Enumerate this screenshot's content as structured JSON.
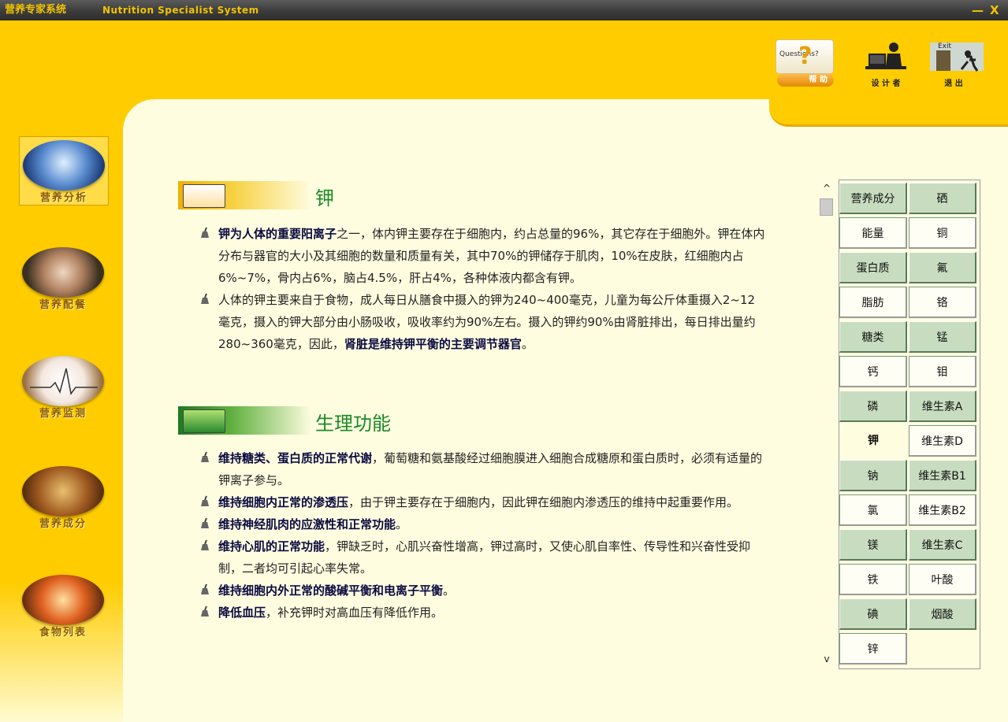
{
  "window": {
    "title_cn": "营养专家系统",
    "title_en": "Nutrition Specialist System",
    "minimize_glyph": "—",
    "close_glyph": "X"
  },
  "toolbar": {
    "help": {
      "card_text": "Questions?",
      "label": "帮 助"
    },
    "designer": {
      "label": "设 计 者"
    },
    "exit": {
      "label": "退 出",
      "sign_text": "Exit"
    }
  },
  "sidebar": {
    "items": [
      {
        "label": "营养分析",
        "icon": "microscope-icon"
      },
      {
        "label": "营养配餐",
        "icon": "meal-plate-icon"
      },
      {
        "label": "营养监测",
        "icon": "heartbeat-monitor-icon"
      },
      {
        "label": "营养成分",
        "icon": "food-basket-icon"
      },
      {
        "label": "食物列表",
        "icon": "vegetables-icon"
      }
    ]
  },
  "content": {
    "section1": {
      "title": "钾",
      "bullets": [
        {
          "bold": "钾为人体的重要阳离子",
          "text": "之一，体内钾主要存在于细胞内，约占总量的96%，其它存在于细胞外。钾在体内分布与器官的大小及其细胞的数量和质量有关，其中70%的钾储存于肌肉，10%在皮肤，红细胞内占6%~7%，骨内占6%，脑占4.5%，肝占4%，各种体液内都含有钾。",
          "tail": ""
        },
        {
          "bold": "",
          "text": "人体的钾主要来自于食物，成人每日从膳食中摄入的钾为240~400毫克，儿童为每公斤体重摄入2~12毫克，摄入的钾大部分由小肠吸收，吸收率约为90%左右。摄入的钾约90%由肾脏排出，每日排出量约280~360毫克，因此，",
          "tail": "肾脏是维持钾平衡的主要调节器官"
        }
      ]
    },
    "section2": {
      "title": "生理功能",
      "bullets": [
        {
          "bold": "维持糖类、蛋白质的正常代谢",
          "text": "，葡萄糖和氨基酸经过细胞膜进入细胞合成糖原和蛋白质时，必须有适量的钾离子参与。"
        },
        {
          "bold": "维持细胞内正常的渗透压",
          "text": "，由于钾主要存在于细胞内，因此钾在细胞内渗透压的维持中起重要作用。"
        },
        {
          "bold": "维持神经肌肉的应激性和正常功能",
          "text": "。"
        },
        {
          "bold": "维持心肌的正常功能",
          "text": "，钾缺乏时，心肌兴奋性增高，钾过高时，又使心肌自率性、传导性和兴奋性受抑制，二者均可引起心率失常。"
        },
        {
          "bold": "维持细胞内外正常的酸碱平衡和电离子平衡",
          "text": "。"
        },
        {
          "bold": "降低血压",
          "text": "，补充钾时对高血压有降低作用。"
        }
      ]
    }
  },
  "grid": {
    "left": [
      "营养成分",
      "能量",
      "蛋白质",
      "脂肪",
      "糖类",
      "钙",
      "磷",
      "钾",
      "钠",
      "氯",
      "镁",
      "铁",
      "碘",
      "锌"
    ],
    "right": [
      "硒",
      "铜",
      "氟",
      "铬",
      "锰",
      "钼",
      "维生素A",
      "维生素D",
      "维生素B1",
      "维生素B2",
      "维生素C",
      "叶酸",
      "烟酸"
    ],
    "selected": "钾",
    "scroll_up": "^",
    "scroll_down": "v"
  },
  "colors": {
    "background": "#ffcc00",
    "panel": "#fffde0",
    "heading_green": "#1c8a28",
    "cell_green": "#c8ddc0"
  }
}
